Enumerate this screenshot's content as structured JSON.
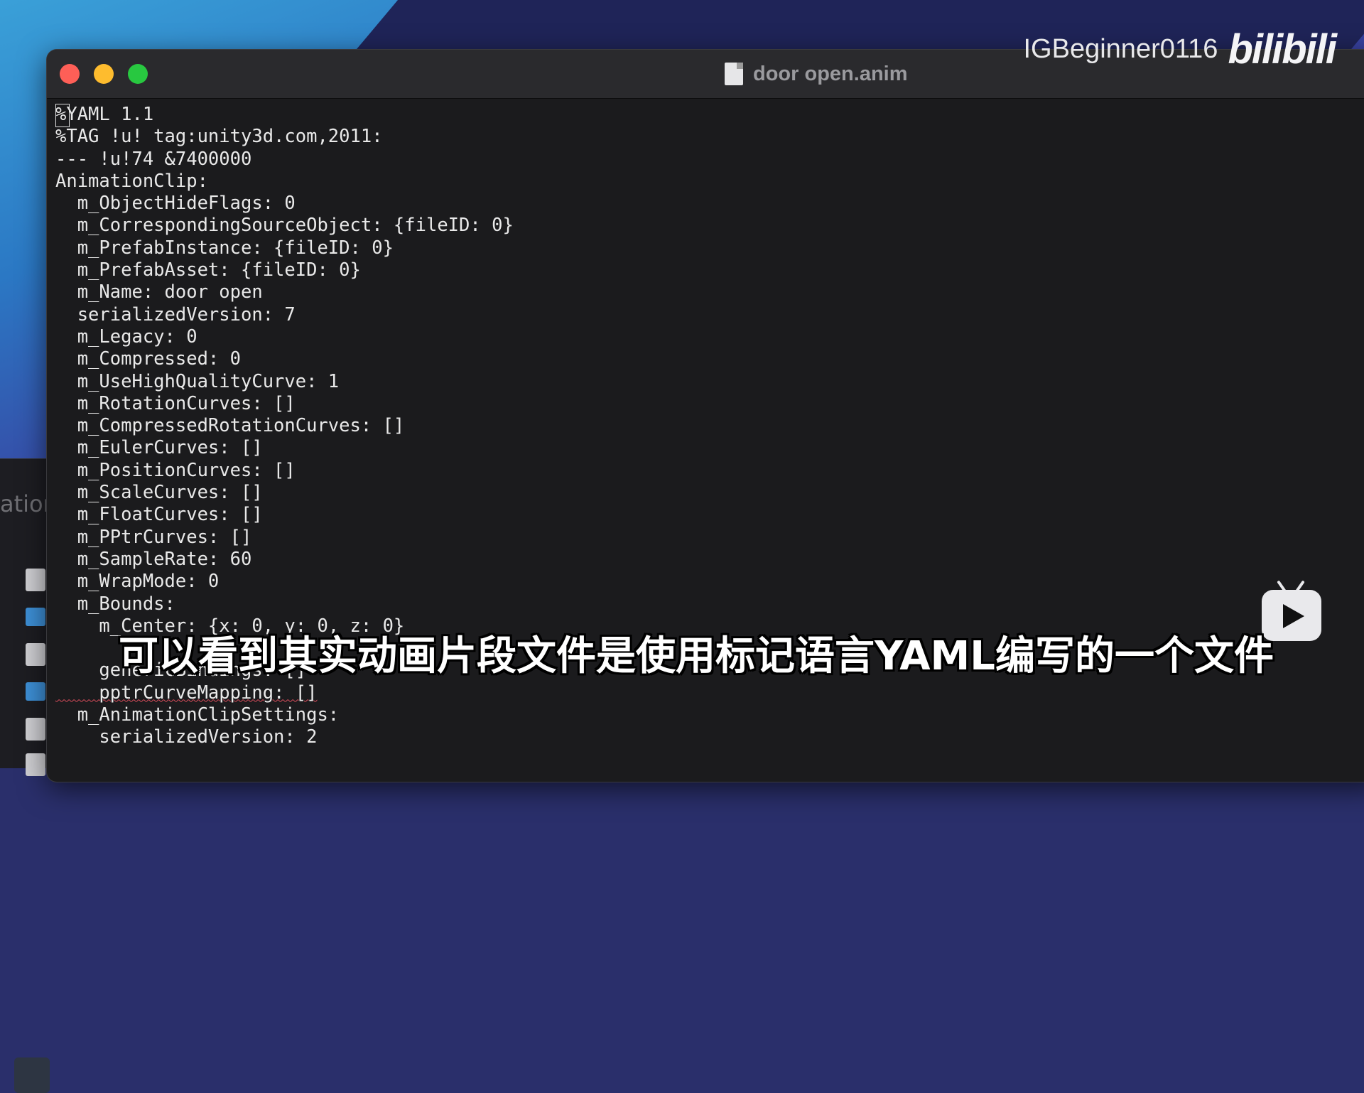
{
  "window": {
    "title": "door open.anim"
  },
  "behind_app": {
    "partial_label": "atior"
  },
  "terminal": {
    "lines": [
      "%YAML 1.1",
      "%TAG !u! tag:unity3d.com,2011:",
      "--- !u!74 &7400000",
      "AnimationClip:",
      "  m_ObjectHideFlags: 0",
      "  m_CorrespondingSourceObject: {fileID: 0}",
      "  m_PrefabInstance: {fileID: 0}",
      "  m_PrefabAsset: {fileID: 0}",
      "  m_Name: door open",
      "  serializedVersion: 7",
      "  m_Legacy: 0",
      "  m_Compressed: 0",
      "  m_UseHighQualityCurve: 1",
      "  m_RotationCurves: []",
      "  m_CompressedRotationCurves: []",
      "  m_EulerCurves: []",
      "  m_PositionCurves: []",
      "  m_ScaleCurves: []",
      "  m_FloatCurves: []",
      "  m_PPtrCurves: []",
      "  m_SampleRate: 60",
      "  m_WrapMode: 0",
      "  m_Bounds:",
      "    m_Center: {x: 0, y: 0, z: 0}",
      "",
      "    genericBindings: []",
      "    pptrCurveMapping: []",
      "  m_AnimationClipSettings:",
      "    serializedVersion: 2"
    ]
  },
  "watermark": {
    "user": "IGBeginner0116",
    "logo_text": "bilibili"
  },
  "subtitle": {
    "text": "可以看到其实动画片段文件是使用标记语言YAML编写的一个文件"
  },
  "colors": {
    "terminal_bg": "#1b1b1d",
    "terminal_text": "#e9e9e9",
    "close": "#fe5f57",
    "minimize": "#febc2e",
    "maximize": "#28c840"
  }
}
